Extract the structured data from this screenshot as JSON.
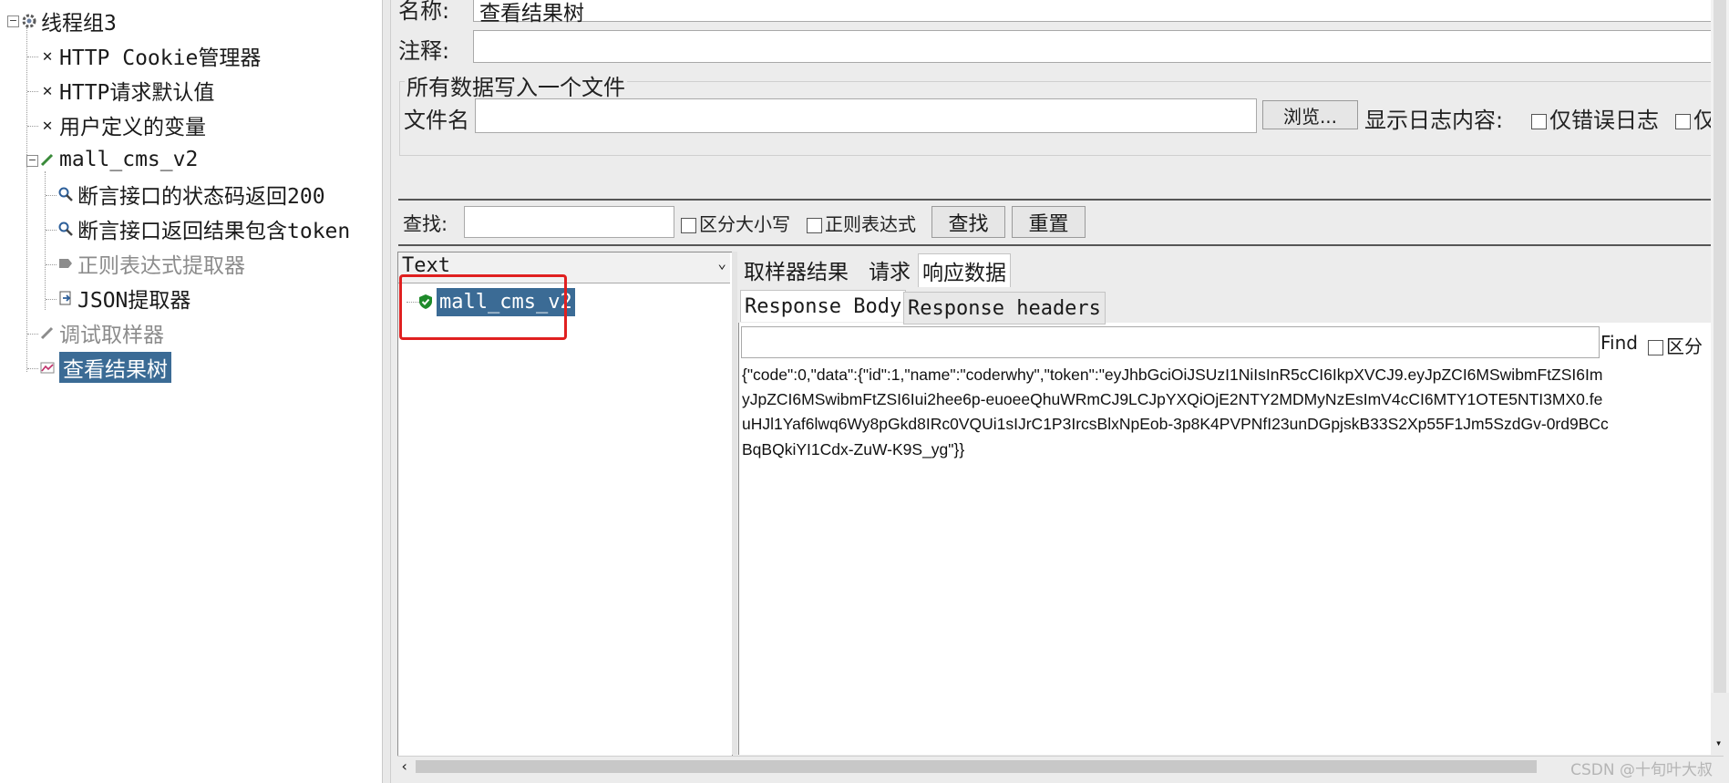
{
  "tree": {
    "root": {
      "label": "线程组3",
      "expander": "⊟"
    },
    "items": [
      {
        "label": "HTTP Cookie管理器",
        "icon": "wrench-icon"
      },
      {
        "label": "HTTP请求默认值",
        "icon": "wrench-icon"
      },
      {
        "label": "用户定义的变量",
        "icon": "wrench-icon"
      },
      {
        "label": "mall_cms_v2",
        "icon": "pipette-icon"
      },
      {
        "label": "断言接口的状态码返回200",
        "icon": "magnifier-icon"
      },
      {
        "label": "断言接口返回结果包含token",
        "icon": "magnifier-icon"
      },
      {
        "label": "正则表达式提取器",
        "icon": "tag-icon",
        "disabled": true
      },
      {
        "label": "JSON提取器",
        "icon": "document-arrow-icon"
      },
      {
        "label": "调试取样器",
        "icon": "pipette-icon",
        "disabled": true
      },
      {
        "label": "查看结果树",
        "icon": "graph-icon",
        "selected": true
      }
    ]
  },
  "form": {
    "name_label": "名称:",
    "name_value": "查看结果树",
    "comment_label": "注释:",
    "comment_value": "",
    "file_group_title": "所有数据写入一个文件",
    "filename_label": "文件名",
    "filename_value": "",
    "browse_button": "浏览...",
    "log_label": "显示日志内容:",
    "errors_only": "仅错误日志",
    "success_only": "仅"
  },
  "search": {
    "label": "查找:",
    "value": "",
    "case_sensitive": "区分大小写",
    "regex": "正则表达式",
    "find_button": "查找",
    "reset_button": "重置"
  },
  "results": {
    "renderer": "Text",
    "sample_label": "mall_cms_v2",
    "tabs": [
      "取样器结果",
      "请求",
      "响应数据"
    ],
    "subtabs": [
      "Response Body",
      "Response headers"
    ],
    "find_label": "Find",
    "find_case": "区分",
    "response_lines": [
      "{\"code\":0,\"data\":{\"id\":1,\"name\":\"coderwhy\",\"token\":\"eyJhbGciOiJSUzI1NiIsInR5cCI6IkpXVCJ9.eyJpZCI6MSwibmFtZSI6Im",
      "yJpZCI6MSwibmFtZSI6Iui2hee6p-euoeeQhuWRmCJ9LCJpYXQiOjE2NTY2MDMyNzEsImV4cCI6MTY1OTE5NTI3MX0.fe",
      "uHJl1Yaf6lwq6Wy8pGkd8IRc0VQUi1sIJrC1P3IrcsBlxNpEob-3p8K4PVPNfI23unDGpjskB33S2Xp55F1Jm5SzdGv-0rd9BCc",
      "BqBQkiYI1Cdx-ZuW-K9S_yg\"}}"
    ]
  },
  "watermark": "CSDN @十旬叶大叔",
  "colors": {
    "selection": "#3b6b95",
    "highlight_box": "#e02020"
  }
}
